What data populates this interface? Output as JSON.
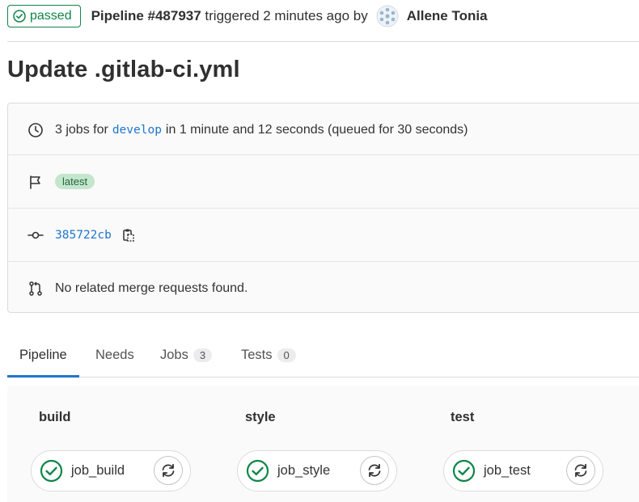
{
  "header": {
    "status": "passed",
    "pipeline_id": "Pipeline #487937",
    "triggered_text": "triggered 2 minutes ago by",
    "author": "Allene Tonia",
    "status_color": "#108548"
  },
  "title": "Update .gitlab-ci.yml",
  "info": {
    "jobs_prefix": "3 jobs for",
    "branch": "develop",
    "jobs_suffix": "in 1 minute and 12 seconds (queued for 30 seconds)",
    "badge": "latest",
    "commit_sha": "385722cb",
    "merge_requests": "No related merge requests found."
  },
  "tabs": [
    {
      "label": "Pipeline",
      "active": true
    },
    {
      "label": "Needs"
    },
    {
      "label": "Jobs",
      "count": "3"
    },
    {
      "label": "Tests",
      "count": "0"
    }
  ],
  "stages": [
    {
      "name": "build",
      "job": "job_build"
    },
    {
      "name": "style",
      "job": "job_style"
    },
    {
      "name": "test",
      "job": "job_test"
    }
  ],
  "icons": {
    "status": "check-circle-icon",
    "clock": "clock-icon",
    "flag": "flag-icon",
    "commit": "commit-icon",
    "copy": "copy-icon",
    "merge": "merge-request-icon",
    "retry": "retry-icon"
  },
  "colors": {
    "accent": "#1f75cb",
    "success": "#108548",
    "badge_bg": "#c3e6cd"
  }
}
